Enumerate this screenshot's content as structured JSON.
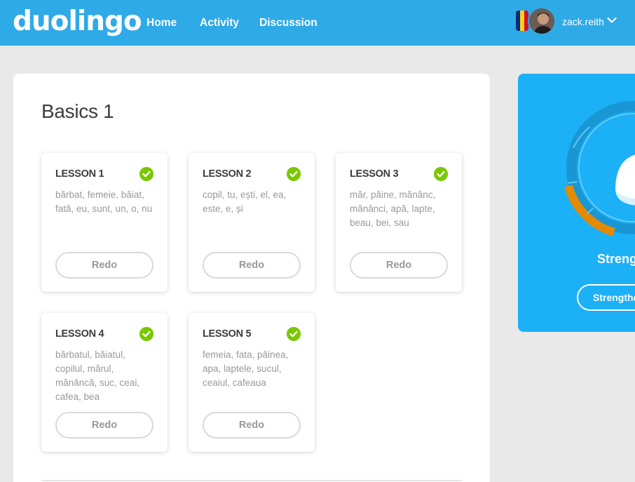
{
  "header": {
    "logo": "duolingo",
    "nav": [
      "Home",
      "Activity",
      "Discussion"
    ],
    "username": "zack.reith",
    "flag_colors": [
      "#002b7f",
      "#fcd116",
      "#ce1126"
    ]
  },
  "skill": {
    "title": "Basics 1",
    "lessons": [
      {
        "title": "LESSON 1",
        "words": "bărbat, femeie, băiat, fată, eu, sunt, un, o, nu",
        "button": "Redo",
        "completed": true
      },
      {
        "title": "LESSON 2",
        "words": "copil, tu, ești, el, ea, este, e, și",
        "button": "Redo",
        "completed": true
      },
      {
        "title": "LESSON 3",
        "words": "măr, pâine, mănânc, mănânci, apă, lapte, beau, bei, sau",
        "button": "Redo",
        "completed": true
      },
      {
        "title": "LESSON 4",
        "words": "bărbatul, băiatul, copilul, mărul, mănâncă, suc, ceai, cafea, bea",
        "button": "Redo",
        "completed": true
      },
      {
        "title": "LESSON 5",
        "words": "femeia, fata, pâinea, apa, laptele, sucul, ceaiul, cafeaua",
        "button": "Redo",
        "completed": true
      }
    ]
  },
  "strengthen": {
    "label": "Streng",
    "button": "Strengthe"
  },
  "colors": {
    "brand_blue": "#2eaae7",
    "panel_blue": "#1cb0f6",
    "check_green": "#78c800",
    "ring_orange": "#e58a00"
  },
  "icons": {
    "check": "check-icon",
    "chevron": "chevron-down-icon",
    "egg": "egg-icon"
  }
}
